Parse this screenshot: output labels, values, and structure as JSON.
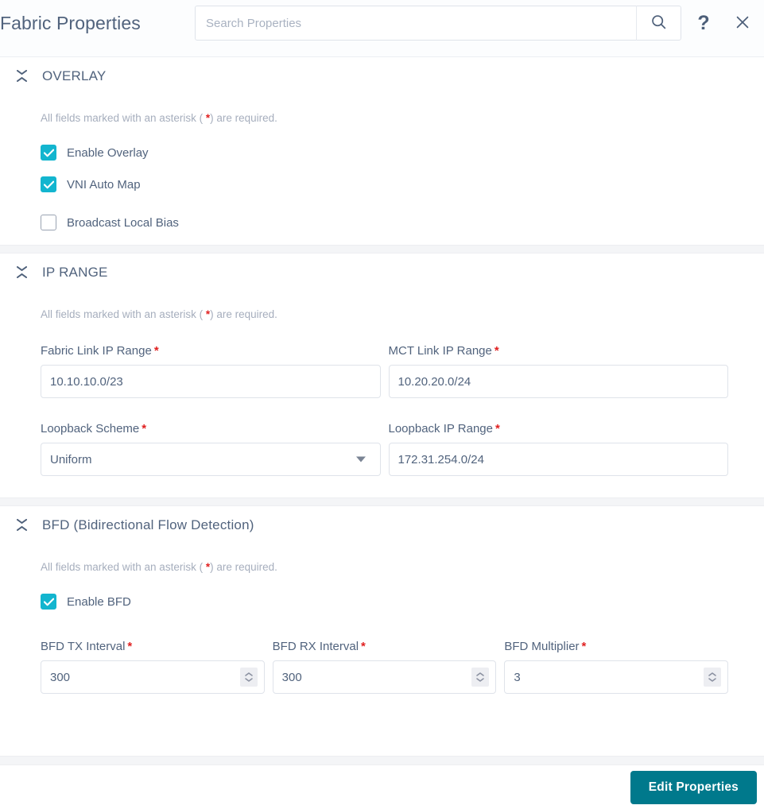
{
  "header": {
    "title": "Fabric Properties",
    "search": {
      "placeholder": "Search Properties",
      "value": "",
      "icon": "search-icon"
    },
    "help_icon": "question-mark-icon",
    "help_label": "?",
    "close_icon": "close-icon"
  },
  "required_note": {
    "prefix": "All fields marked with an asterisk ( ",
    "star": "*",
    "suffix": ") are required."
  },
  "sections": [
    {
      "id": "overlay",
      "title": "OVERLAY",
      "collapse_icon": "collapse-icon",
      "checkboxes": [
        {
          "label": "Enable Overlay",
          "checked": true
        },
        {
          "label": "VNI Auto Map",
          "checked": true
        },
        {
          "label": "Broadcast Local Bias",
          "checked": false
        }
      ]
    },
    {
      "id": "ip-range",
      "title": "IP RANGE",
      "collapse_icon": "collapse-icon",
      "fields": [
        {
          "label": "Fabric Link IP Range",
          "required": true,
          "type": "text",
          "value": "10.10.10.0/23"
        },
        {
          "label": "MCT Link IP Range",
          "required": true,
          "type": "text",
          "value": "10.20.20.0/24"
        },
        {
          "label": "Loopback Scheme",
          "required": true,
          "type": "select",
          "value": "Uniform"
        },
        {
          "label": "Loopback IP Range",
          "required": true,
          "type": "text",
          "value": "172.31.254.0/24"
        }
      ]
    },
    {
      "id": "bfd",
      "title": "BFD (Bidirectional Flow Detection)",
      "collapse_icon": "collapse-icon",
      "checkboxes": [
        {
          "label": "Enable BFD",
          "checked": true
        }
      ],
      "fields": [
        {
          "label": "BFD TX Interval",
          "required": true,
          "type": "number",
          "value": "300"
        },
        {
          "label": "BFD RX Interval",
          "required": true,
          "type": "number",
          "value": "300"
        },
        {
          "label": "BFD Multiplier",
          "required": true,
          "type": "number",
          "value": "3"
        }
      ]
    }
  ],
  "footer": {
    "edit_properties_label": "Edit Properties"
  },
  "colors": {
    "accent_teal": "#00798c",
    "checkbox_cyan": "#13b5cf",
    "required_red": "#e02020",
    "text_slate": "#51637d",
    "muted": "#a6aebd",
    "border": "#dfe3ea",
    "band": "#f4f5f7"
  }
}
